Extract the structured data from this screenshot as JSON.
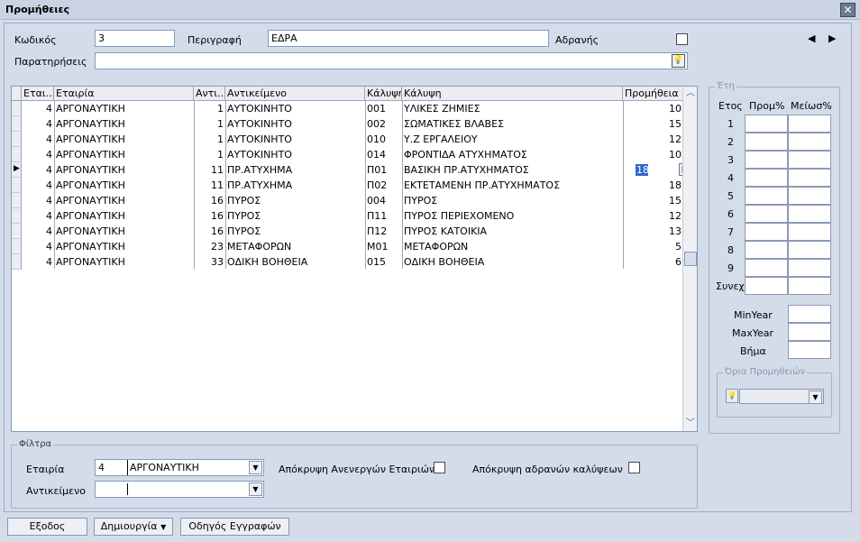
{
  "window": {
    "title": "Προμήθειες",
    "close": "✕"
  },
  "form": {
    "code_label": "Κωδικός",
    "code_value": "3",
    "desc_label": "Περιγραφή",
    "desc_value": "ΕΔΡΑ",
    "inactive_label": "Αδρανής",
    "notes_label": "Παρατηρήσεις",
    "notes_value": "",
    "nav_prev": "◀",
    "nav_next": "▶"
  },
  "grid": {
    "columns": [
      "Εται...",
      "Εταιρία",
      "Αντι...",
      "Αντικείμενο",
      "Κάλυψη",
      "Κάλυψη",
      "Προμήθεια"
    ],
    "rows": [
      [
        "4",
        "ΑΡΓΟΝΑΥΤΙΚΗ",
        "1",
        "ΑΥΤΟΚΙΝΗΤΟ",
        "001",
        "ΥΛΙΚΕΣ ΖΗΜΙΕΣ",
        "10"
      ],
      [
        "4",
        "ΑΡΓΟΝΑΥΤΙΚΗ",
        "1",
        "ΑΥΤΟΚΙΝΗΤΟ",
        "002",
        "ΣΩΜΑΤΙΚΕΣ ΒΛΑΒΕΣ",
        "15"
      ],
      [
        "4",
        "ΑΡΓΟΝΑΥΤΙΚΗ",
        "1",
        "ΑΥΤΟΚΙΝΗΤΟ",
        "010",
        "Υ.Ζ ΕΡΓΑΛΕΙΟΥ",
        "12"
      ],
      [
        "4",
        "ΑΡΓΟΝΑΥΤΙΚΗ",
        "1",
        "ΑΥΤΟΚΙΝΗΤΟ",
        "014",
        "ΦΡΟΝΤΙΔΑ ΑΤΥΧΗΜΑΤΟΣ",
        "10"
      ],
      [
        "4",
        "ΑΡΓΟΝΑΥΤΙΚΗ",
        "11",
        "ΠΡ.ΑΤΥΧΗΜΑ",
        "Π01",
        "ΒΑΣΙΚΗ ΠΡ.ΑΤΥΧΗΜΑΤΟΣ",
        "18"
      ],
      [
        "4",
        "ΑΡΓΟΝΑΥΤΙΚΗ",
        "11",
        "ΠΡ.ΑΤΥΧΗΜΑ",
        "Π02",
        "ΕΚΤΕΤΑΜΕΝΗ ΠΡ.ΑΤΥΧΗΜΑΤΟΣ",
        "18"
      ],
      [
        "4",
        "ΑΡΓΟΝΑΥΤΙΚΗ",
        "16",
        "ΠΥΡΟΣ",
        "004",
        "ΠΥΡΟΣ",
        "15"
      ],
      [
        "4",
        "ΑΡΓΟΝΑΥΤΙΚΗ",
        "16",
        "ΠΥΡΟΣ",
        "Π11",
        "ΠΥΡΟΣ ΠΕΡΙΕΧΟΜΕΝΟ",
        "12"
      ],
      [
        "4",
        "ΑΡΓΟΝΑΥΤΙΚΗ",
        "16",
        "ΠΥΡΟΣ",
        "Π12",
        "ΠΥΡΟΣ ΚΑΤΟΙΚΙΑ",
        "13"
      ],
      [
        "4",
        "ΑΡΓΟΝΑΥΤΙΚΗ",
        "23",
        "ΜΕΤΑΦΟΡΩΝ",
        "Μ01",
        "ΜΕΤΑΦΟΡΩΝ",
        "5"
      ],
      [
        "4",
        "ΑΡΓΟΝΑΥΤΙΚΗ",
        "33",
        "ΟΔΙΚΗ ΒΟΗΘΕΙΑ",
        "015",
        "ΟΔΙΚΗ ΒΟΗΘΕΙΑ",
        "6"
      ]
    ],
    "current_row": 4
  },
  "eti": {
    "title": "Έτη",
    "col_year": "Ετος",
    "col_prom": "Προμ%",
    "col_meiosi": "Μείωσ%",
    "years": [
      "1",
      "2",
      "3",
      "4",
      "5",
      "6",
      "7",
      "8",
      "9",
      "Συνεχ"
    ],
    "minyear_label": "MinYear",
    "maxyear_label": "MaxYear",
    "step_label": "Βήμα",
    "oria_title": "Όρια Προμηθειών"
  },
  "filters": {
    "title": "Φίλτρα",
    "company_label": "Εταιρία",
    "company_code": "4",
    "company_name": "ΑΡΓΟΝΑΥΤΙΚΗ",
    "object_label": "Αντικείμενο",
    "object_value": "",
    "hide_inactive_companies": "Απόκρυψη Ανενεργών Εταιριών",
    "hide_inactive_coverages": "Απόκρυψη αδρανών καλύψεων"
  },
  "buttons": {
    "exit": "Εξοδος",
    "create": "Δημιουργία",
    "wizard": "Οδηγός Εγγραφών"
  }
}
